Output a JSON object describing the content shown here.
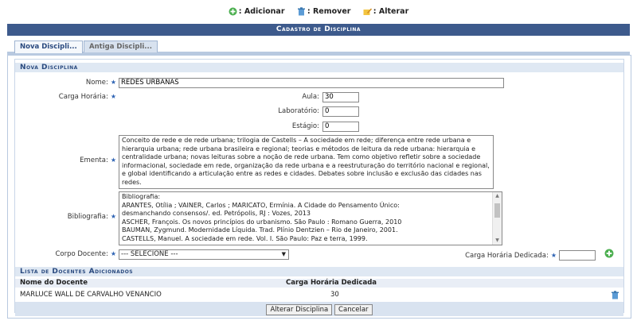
{
  "legend": {
    "add": ": Adicionar",
    "remove": ": Remover",
    "edit": ": Alterar"
  },
  "title": "Cadastro de Disciplina",
  "tabs": [
    {
      "label": "Nova Discipli..."
    },
    {
      "label": "Antiga Discipli..."
    }
  ],
  "section_new": "Nova Disciplina",
  "form": {
    "nome_label": "Nome:",
    "nome_value": "REDES URBANAS",
    "carga_label": "Carga Horária:",
    "aula_label": "Aula:",
    "aula_value": "30",
    "lab_label": "Laboratório:",
    "lab_value": "0",
    "estagio_label": "Estágio:",
    "estagio_value": "0",
    "ementa_label": "Ementa:",
    "ementa_value": "Conceito de rede e de rede urbana; trilogia de Castells – A sociedade em rede; diferença entre rede urbana e hierarquia urbana; rede urbana brasileira e regional; teorias e métodos de leitura da rede urbana: hierarquia e centralidade urbana; novas leituras sobre a noção de rede urbana. Tem como objetivo refletir sobre a sociedade informacional, sociedade em rede, organização da rede urbana e a reestruturação do território nacional e regional, e global identificando a articulação entre as redes e cidades. Debates sobre inclusão e exclusão das cidades nas redes.",
    "biblio_label": "Bibliografia:",
    "biblio_lines": [
      "Bibliografia:",
      "ARANTES, Otília ; VAINER, Carlos ; MARICATO, Ermínia. A Cidade do Pensamento Único:",
      "desmanchando  consensos/. ed. Petrópolis, RJ : Vozes, 2013",
      "ASCHER, François. Os novos princípios do urbanismo. São Paulo : Romano Guerra, 2010",
      "BAUMAN, Zygmund. Modernidade Líquida. Trad. Plínio Dentzien – Rio de Janeiro, 2001.",
      "CASTELLS, Manuel. A sociedade em rede. Vol. I. São Paulo: Paz e terra, 1999."
    ],
    "corpo_label": "Corpo Docente:",
    "corpo_value": "--- SELECIONE ---",
    "carga_dedicada_label": "Carga Horária Dedicada:",
    "carga_dedicada_value": ""
  },
  "section_docentes": "Lista de Docentes Adicionados",
  "table": {
    "headers": [
      "Nome do Docente",
      "Carga Horária Dedicada"
    ],
    "rows": [
      {
        "nome": "MARLUCE WALL DE CARVALHO VENANCIO",
        "carga": "30"
      }
    ]
  },
  "buttons": {
    "alterar": "Alterar Disciplina",
    "cancelar": "Cancelar"
  },
  "required_mark": "★"
}
